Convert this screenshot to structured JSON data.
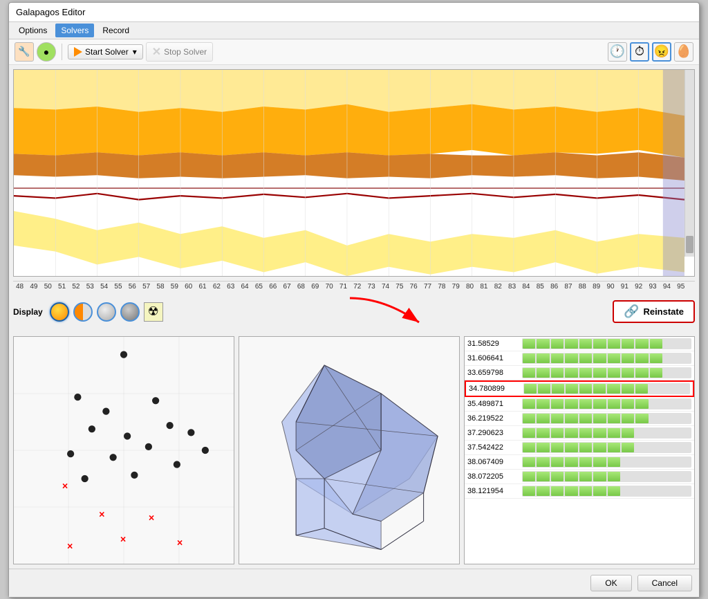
{
  "window": {
    "title": "Galapagos Editor"
  },
  "menu": {
    "items": [
      {
        "id": "options",
        "label": "Options",
        "active": false
      },
      {
        "id": "solvers",
        "label": "Solvers",
        "active": true
      },
      {
        "id": "record",
        "label": "Record",
        "active": false
      }
    ]
  },
  "toolbar": {
    "start_solver_label": "Start Solver",
    "stop_solver_label": "Stop Solver",
    "dropdown_arrow": "▾"
  },
  "display": {
    "label": "Display",
    "reinstate_label": "Reinstate"
  },
  "x_axis_labels": [
    "48",
    "49",
    "50",
    "51",
    "52",
    "53",
    "54",
    "55",
    "56",
    "57",
    "58",
    "59",
    "60",
    "61",
    "62",
    "63",
    "64",
    "65",
    "66",
    "67",
    "68",
    "69",
    "70",
    "71",
    "72",
    "73",
    "74",
    "75",
    "76",
    "77",
    "78",
    "79",
    "80",
    "81",
    "82",
    "83",
    "84",
    "85",
    "86",
    "87",
    "88",
    "89",
    "90",
    "91",
    "92",
    "93",
    "94",
    "95"
  ],
  "values": [
    {
      "num": "31.58529",
      "fill": 0.85,
      "highlighted": false
    },
    {
      "num": "31.606641",
      "fill": 0.84,
      "highlighted": false
    },
    {
      "num": "33.659798",
      "fill": 0.8,
      "highlighted": false
    },
    {
      "num": "34.780899",
      "fill": 0.78,
      "highlighted": true
    },
    {
      "num": "35.489871",
      "fill": 0.75,
      "highlighted": false
    },
    {
      "num": "36.219522",
      "fill": 0.72,
      "highlighted": false
    },
    {
      "num": "37.290623",
      "fill": 0.68,
      "highlighted": false
    },
    {
      "num": "37.542422",
      "fill": 0.65,
      "highlighted": false
    },
    {
      "num": "38.067409",
      "fill": 0.6,
      "highlighted": false
    },
    {
      "num": "38.072205",
      "fill": 0.58,
      "highlighted": false
    },
    {
      "num": "38.121954",
      "fill": 0.55,
      "highlighted": false
    }
  ],
  "footer": {
    "ok_label": "OK",
    "cancel_label": "Cancel"
  },
  "colors": {
    "accent": "#4a90d9",
    "orange_bright": "#ffb300",
    "orange_dark": "#cc7000",
    "orange_medium": "#e8900a",
    "chart_bg": "#ffffff",
    "highlight_red": "#cc0000"
  }
}
